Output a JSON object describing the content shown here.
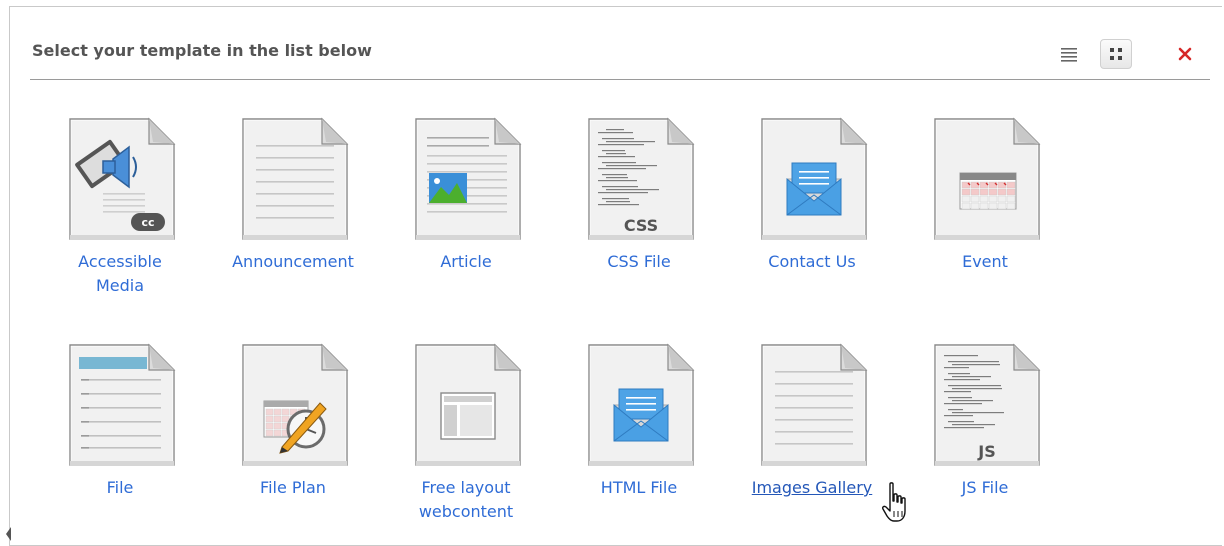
{
  "header": {
    "title": "Select your template in the list below"
  },
  "toolbar": {
    "list_view_icon": "list-view-icon",
    "grid_view_icon": "grid-view-icon",
    "close_icon": "close-icon",
    "close_color": "#d62828"
  },
  "colors": {
    "link": "#2f6cd6",
    "divider": "#9a9a9a",
    "title": "#555555"
  },
  "templates": [
    {
      "label": "Accessible Media",
      "icon": "media-cc-icon"
    },
    {
      "label": "Announcement",
      "icon": "text-document-icon"
    },
    {
      "label": "Article",
      "icon": "article-image-icon"
    },
    {
      "label": "CSS File",
      "icon": "css-file-icon",
      "badge": "CSS"
    },
    {
      "label": "Contact Us",
      "icon": "envelope-icon"
    },
    {
      "label": "Event",
      "icon": "calendar-icon"
    },
    {
      "label": "File",
      "icon": "file-lines-icon"
    },
    {
      "label": "File Plan",
      "icon": "calendar-clock-icon"
    },
    {
      "label": "Free layout webcontent",
      "icon": "layout-icon"
    },
    {
      "label": "HTML File",
      "icon": "envelope-icon"
    },
    {
      "label": "Images Gallery",
      "icon": "text-document-icon",
      "hovered": true
    },
    {
      "label": "JS File",
      "icon": "js-file-icon",
      "badge": "JS"
    }
  ]
}
